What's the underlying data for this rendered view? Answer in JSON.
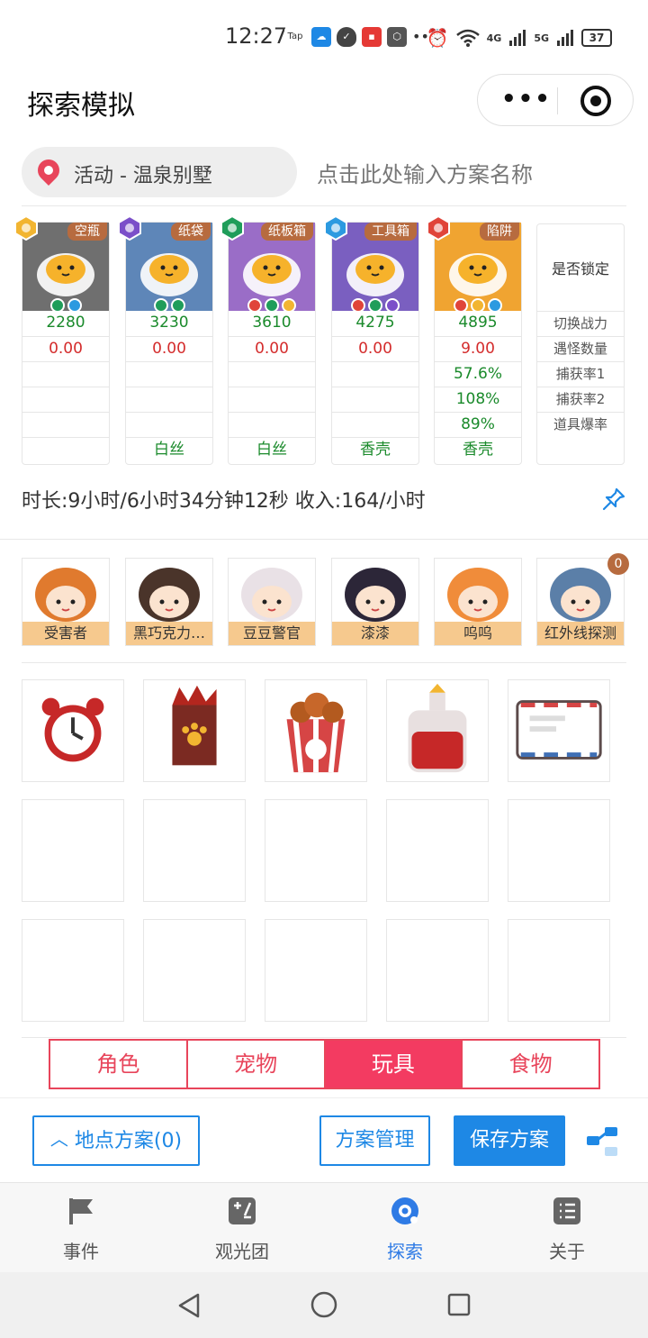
{
  "status_bar": {
    "time": "12:27",
    "icons": [
      "taptap-icon",
      "weather-icon",
      "shield-icon",
      "news-icon",
      "hexagon-icon",
      "more-icon"
    ],
    "right_icons": [
      "alarm-icon",
      "wifi-icon",
      "4g-signal-icon",
      "5g-signal-icon"
    ],
    "network_a": "4G",
    "network_b": "5G",
    "battery": "37"
  },
  "title_bar": {
    "title": "探索模拟",
    "more_label": "•••"
  },
  "location": {
    "text": "活动 - 温泉别墅",
    "plan_placeholder": "点击此处输入方案名称"
  },
  "pets": [
    {
      "tag": "空瓶",
      "power": "2280",
      "count": "0.00",
      "rate1": "",
      "rate2": "",
      "drop": "",
      "item": "",
      "badge_color": "#f2b531",
      "bg": "#6f6f6f",
      "dots": [
        "#1f9d5a",
        "#2c9ae0"
      ]
    },
    {
      "tag": "纸袋",
      "power": "3230",
      "count": "0.00",
      "rate1": "",
      "rate2": "",
      "drop": "",
      "item": "白丝",
      "badge_color": "#7b4fc9",
      "bg": "#5e86b8",
      "dots": [
        "#1f9d5a",
        "#1f9d5a"
      ]
    },
    {
      "tag": "纸板箱",
      "power": "3610",
      "count": "0.00",
      "rate1": "",
      "rate2": "",
      "drop": "",
      "item": "白丝",
      "badge_color": "#1f9d5a",
      "bg": "#9a6dc7",
      "dots": [
        "#e0443a",
        "#1f9d5a",
        "#f2b531"
      ]
    },
    {
      "tag": "工具箱",
      "power": "4275",
      "count": "0.00",
      "rate1": "",
      "rate2": "",
      "drop": "",
      "item": "香壳",
      "badge_color": "#2c9ae0",
      "bg": "#7a5fc0",
      "dots": [
        "#e0443a",
        "#1f9d5a",
        "#7b4fc9"
      ]
    },
    {
      "tag": "陷阱",
      "power": "4895",
      "count": "9.00",
      "rate1": "57.6%",
      "rate2": "108%",
      "drop": "89%",
      "item": "香壳",
      "badge_color": "#e0443a",
      "bg": "#f0a431",
      "dots": [
        "#e0443a",
        "#f2b531",
        "#2c9ae0"
      ]
    }
  ],
  "lock_column": {
    "title": "是否锁定",
    "labels": [
      "切换战力",
      "遇怪数量",
      "捕获率1",
      "捕获率2",
      "道具爆率"
    ]
  },
  "summary": "时长:9小时/6小时34分钟12秒 收入:164/小时",
  "people": [
    {
      "name": "受害者",
      "hair": "#e07a2e"
    },
    {
      "name": "黑巧克力…",
      "hair": "#4a342a"
    },
    {
      "name": "豆豆警官",
      "hair": "#e9e1e6"
    },
    {
      "name": "漆漆",
      "hair": "#2c2638"
    },
    {
      "name": "呜呜",
      "hair": "#f08c3a"
    },
    {
      "name": "红外线探测",
      "hair": "#5b7fa8",
      "count": "0"
    }
  ],
  "toys": [
    "alarm-clock-icon",
    "paw-box-icon",
    "popcorn-bucket-icon",
    "potion-bottle-icon",
    "envelope-icon"
  ],
  "tabs": [
    {
      "label": "角色",
      "active": false
    },
    {
      "label": "宠物",
      "active": false
    },
    {
      "label": "玩具",
      "active": true
    },
    {
      "label": "食物",
      "active": false
    }
  ],
  "actions": {
    "location_plan": "地点方案(0)",
    "plan_manage": "方案管理",
    "save_plan": "保存方案"
  },
  "bottom_nav": [
    {
      "label": "事件",
      "icon": "flag-icon",
      "active": false
    },
    {
      "label": "观光团",
      "icon": "calculator-icon",
      "active": false
    },
    {
      "label": "探索",
      "icon": "explore-icon",
      "active": true
    },
    {
      "label": "关于",
      "icon": "list-icon",
      "active": false
    }
  ],
  "colors": {
    "accent_blue": "#1e88e5",
    "tab_pink": "#f33b61",
    "power_green": "#1a8a2b",
    "value_red": "#d42c2c",
    "tag_brown": "#b76b3f"
  }
}
